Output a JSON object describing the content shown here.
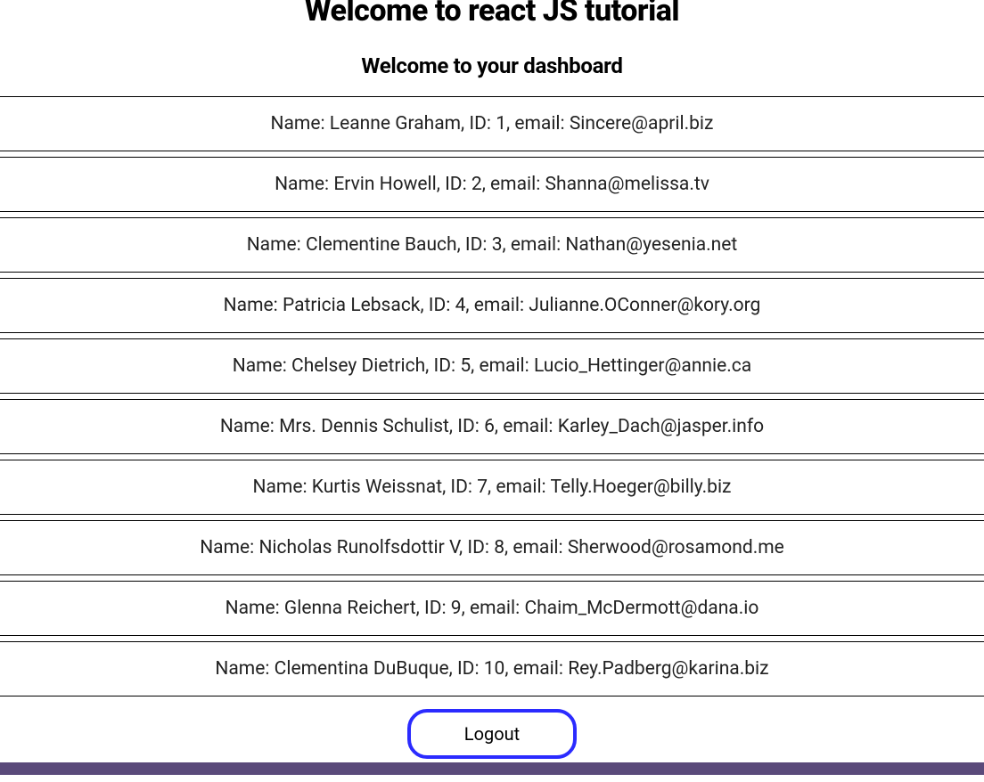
{
  "header": {
    "main_title": "Welcome to react JS tutorial",
    "sub_title": "Welcome to your dashboard"
  },
  "labels": {
    "name_prefix": "Name: ",
    "id_prefix": ", ID: ",
    "email_prefix": ", email: "
  },
  "users": [
    {
      "name": "Leanne Graham",
      "id": "1",
      "email": "Sincere@april.biz"
    },
    {
      "name": "Ervin Howell",
      "id": "2",
      "email": "Shanna@melissa.tv"
    },
    {
      "name": "Clementine Bauch",
      "id": "3",
      "email": "Nathan@yesenia.net"
    },
    {
      "name": "Patricia Lebsack",
      "id": "4",
      "email": "Julianne.OConner@kory.org"
    },
    {
      "name": "Chelsey Dietrich",
      "id": "5",
      "email": "Lucio_Hettinger@annie.ca"
    },
    {
      "name": "Mrs. Dennis Schulist",
      "id": "6",
      "email": "Karley_Dach@jasper.info"
    },
    {
      "name": "Kurtis Weissnat",
      "id": "7",
      "email": "Telly.Hoeger@billy.biz"
    },
    {
      "name": "Nicholas Runolfsdottir V",
      "id": "8",
      "email": "Sherwood@rosamond.me"
    },
    {
      "name": "Glenna Reichert",
      "id": "9",
      "email": "Chaim_McDermott@dana.io"
    },
    {
      "name": "Clementina DuBuque",
      "id": "10",
      "email": "Rey.Padberg@karina.biz"
    }
  ],
  "buttons": {
    "logout": "Logout"
  }
}
